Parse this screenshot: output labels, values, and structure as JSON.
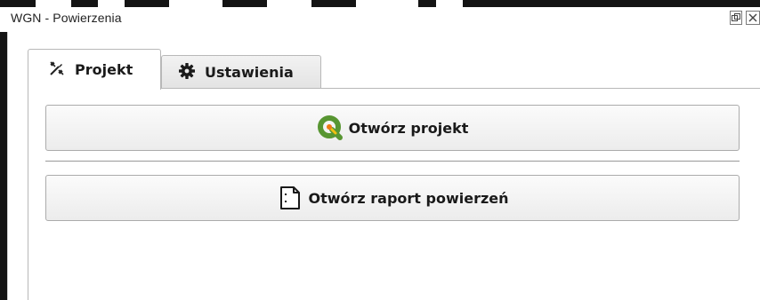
{
  "window": {
    "title": "WGN - Powierzenia",
    "float_icon": "restore-icon",
    "close_icon": "close-icon"
  },
  "tabs": [
    {
      "label": "Projekt",
      "icon": "pencil-ruler-icon",
      "active": true
    },
    {
      "label": "Ustawienia",
      "icon": "gear-icon",
      "active": false
    }
  ],
  "buttons": {
    "open_project": {
      "label": "Otwórz projekt",
      "icon": "qgis-logo-icon"
    },
    "open_report": {
      "label": "Otwórz raport powierzeń",
      "icon": "document-icon"
    }
  },
  "colors": {
    "qgis_green": "#589632",
    "qgis_yellow": "#f0c010",
    "window_bg": "#141414"
  }
}
